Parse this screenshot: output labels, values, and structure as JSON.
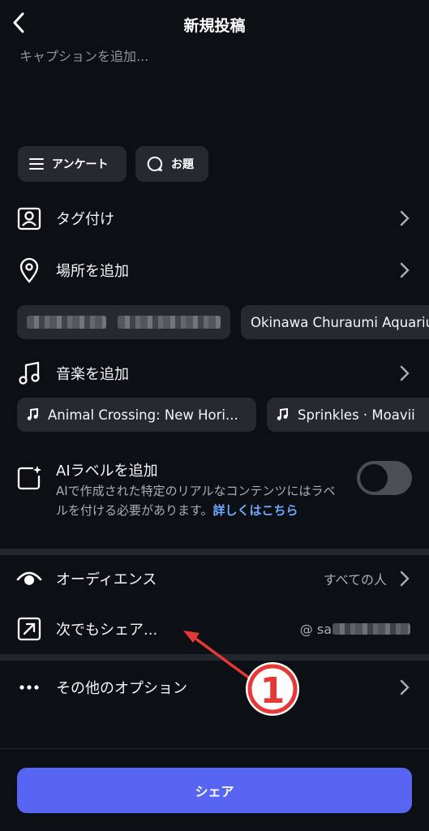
{
  "header": {
    "title": "新規投稿"
  },
  "caption": {
    "placeholder": "キャプションを追加..."
  },
  "chips": [
    {
      "label": "アンケート",
      "icon": "list-icon"
    },
    {
      "label": "お題",
      "icon": "chat-bubble-icon"
    }
  ],
  "rows": {
    "tag": {
      "label": "タグ付け",
      "icon": "person-tag-icon"
    },
    "location": {
      "label": "場所を追加",
      "icon": "location-pin-icon"
    },
    "music": {
      "label": "音楽を追加",
      "icon": "music-note-icon"
    },
    "audience": {
      "label": "オーディエンス",
      "value": "すべての人",
      "icon": "eye-icon"
    },
    "share_to": {
      "label": "次でもシェア...",
      "value": "@ sa",
      "icon": "share-arrow-icon"
    },
    "more": {
      "label": "その他のオプション",
      "icon": "ellipsis-icon"
    }
  },
  "location_suggestions": [
    "Okinawa Churaumi Aquarium"
  ],
  "music_suggestions": [
    "Animal Crossing: New Hori...",
    "Sprinkles · Moavii"
  ],
  "ai_label": {
    "title": "AIラベルを追加",
    "description": "AIで作成された特定のリアルなコンテンツにはラベルを付ける必要があります。",
    "link": "詳しくはこちら",
    "enabled": false
  },
  "annotation": {
    "number": "1"
  },
  "share_button": {
    "label": "シェア"
  },
  "colors": {
    "background": "#0c1014",
    "accent": "#5865f2",
    "link": "#6ea8ff",
    "annotation": "#e53935"
  }
}
